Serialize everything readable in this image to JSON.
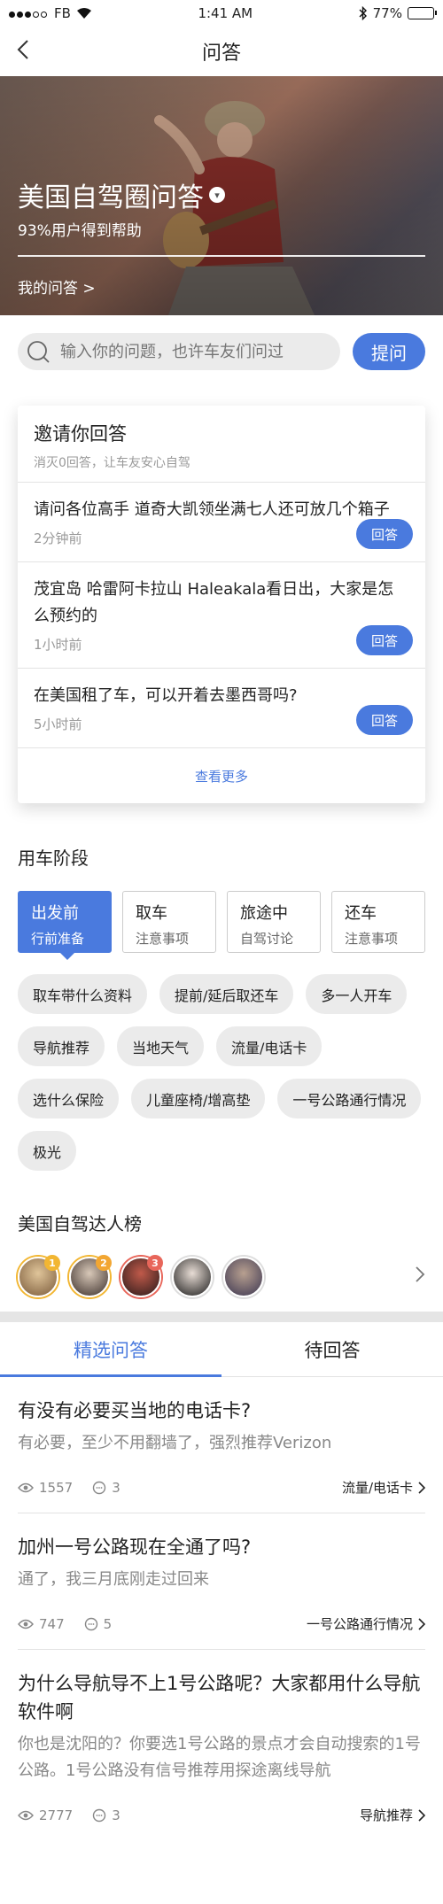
{
  "status": {
    "carrier": "FB",
    "time": "1:41 AM",
    "battery": "77%",
    "battery_level": 0.77
  },
  "nav": {
    "title": "问答"
  },
  "hero": {
    "title": "美国自驾圈问答",
    "subtitle": "93%用户得到帮助",
    "my_answers": "我的问答 >"
  },
  "search": {
    "placeholder": "输入你的问题，也许车友们问过",
    "ask_button": "提问"
  },
  "invite": {
    "title": "邀请你回答",
    "subtitle": "消灭0回答，让车友安心自驾",
    "questions": [
      {
        "text": "请问各位高手 道奇大凯领坐满七人还可放几个箱子",
        "time": "2分钟前",
        "button": "回答"
      },
      {
        "text": "茂宜岛 哈雷阿卡拉山 Haleakala看日出，大家是怎么预约的",
        "time": "1小时前",
        "button": "回答"
      },
      {
        "text": "在美国租了车，可以开着去墨西哥吗?",
        "time": "5小时前",
        "button": "回答"
      }
    ],
    "more": "查看更多"
  },
  "stages": {
    "title": "用车阶段",
    "items": [
      {
        "a": "出发前",
        "b": "行前准备"
      },
      {
        "a": "取车",
        "b": "注意事项"
      },
      {
        "a": "旅途中",
        "b": "自驾讨论"
      },
      {
        "a": "还车",
        "b": "注意事项"
      }
    ],
    "tags": [
      "取车带什么资料",
      "提前/延后取还车",
      "多一人开车",
      "导航推荐",
      "当地天气",
      "流量/电话卡",
      "选什么保险",
      "儿童座椅/增高垫",
      "一号公路通行情况",
      "极光"
    ]
  },
  "ranking": {
    "title": "美国自驾达人榜",
    "badges": [
      "1",
      "2",
      "3"
    ]
  },
  "tabs": {
    "featured": "精选问答",
    "pending": "待回答"
  },
  "posts": [
    {
      "title": "有没有必要买当地的电话卡?",
      "desc": "有必要，至少不用翻墙了，强烈推荐Verizon",
      "views": "1557",
      "comments": "3",
      "category": "流量/电话卡"
    },
    {
      "title": "加州一号公路现在全通了吗?",
      "desc": "通了，我三月底刚走过回来",
      "views": "747",
      "comments": "5",
      "category": "一号公路通行情况"
    },
    {
      "title": "为什么导航导不上1号公路呢？大家都用什么导航软件啊",
      "desc": "你也是沈阳的？你要选1号公路的景点才会自动搜索的1号公路。1号公路没有信号推荐用探途离线导航",
      "views": "2777",
      "comments": "3",
      "category": "导航推荐"
    }
  ],
  "colors": {
    "accent": "#4a7ade",
    "tag_bg": "#ebebeb"
  }
}
